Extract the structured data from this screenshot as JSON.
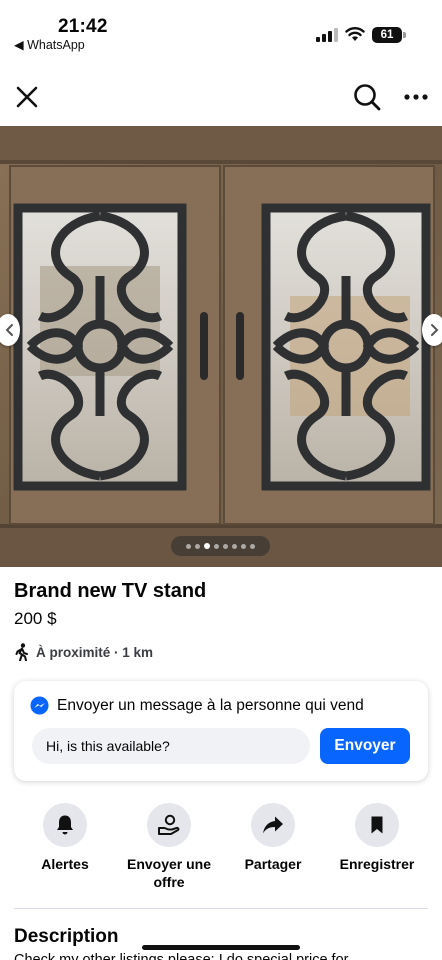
{
  "status_bar": {
    "time": "21:42",
    "back_app": "◀ WhatsApp",
    "battery": "61"
  },
  "nav": {
    "close_icon": "close-icon",
    "search_icon": "search-icon",
    "more_icon": "more-dots-icon"
  },
  "carousel": {
    "image_description_icon": "product-photo",
    "dot_count": 8,
    "active_index": 2
  },
  "listing": {
    "title": "Brand new TV stand",
    "price": "200 $",
    "proximity": "À proximité · 1 km"
  },
  "message_card": {
    "heading": "Envoyer un message à la personne qui vend",
    "input_value": "Hi, is this available?",
    "send_label": "Envoyer"
  },
  "actions": [
    {
      "label": "Alertes",
      "icon": "bell-icon"
    },
    {
      "label": "Envoyer une offre",
      "icon": "offer-hand-icon"
    },
    {
      "label": "Partager",
      "icon": "share-arrow-icon"
    },
    {
      "label": "Enregistrer",
      "icon": "bookmark-icon"
    }
  ],
  "description": {
    "title": "Description",
    "text": "Check my other listings please: I do special price for"
  },
  "colors": {
    "accent": "#0866ff",
    "chip_bg": "#e4e6eb",
    "input_bg": "#f0f2f5"
  }
}
